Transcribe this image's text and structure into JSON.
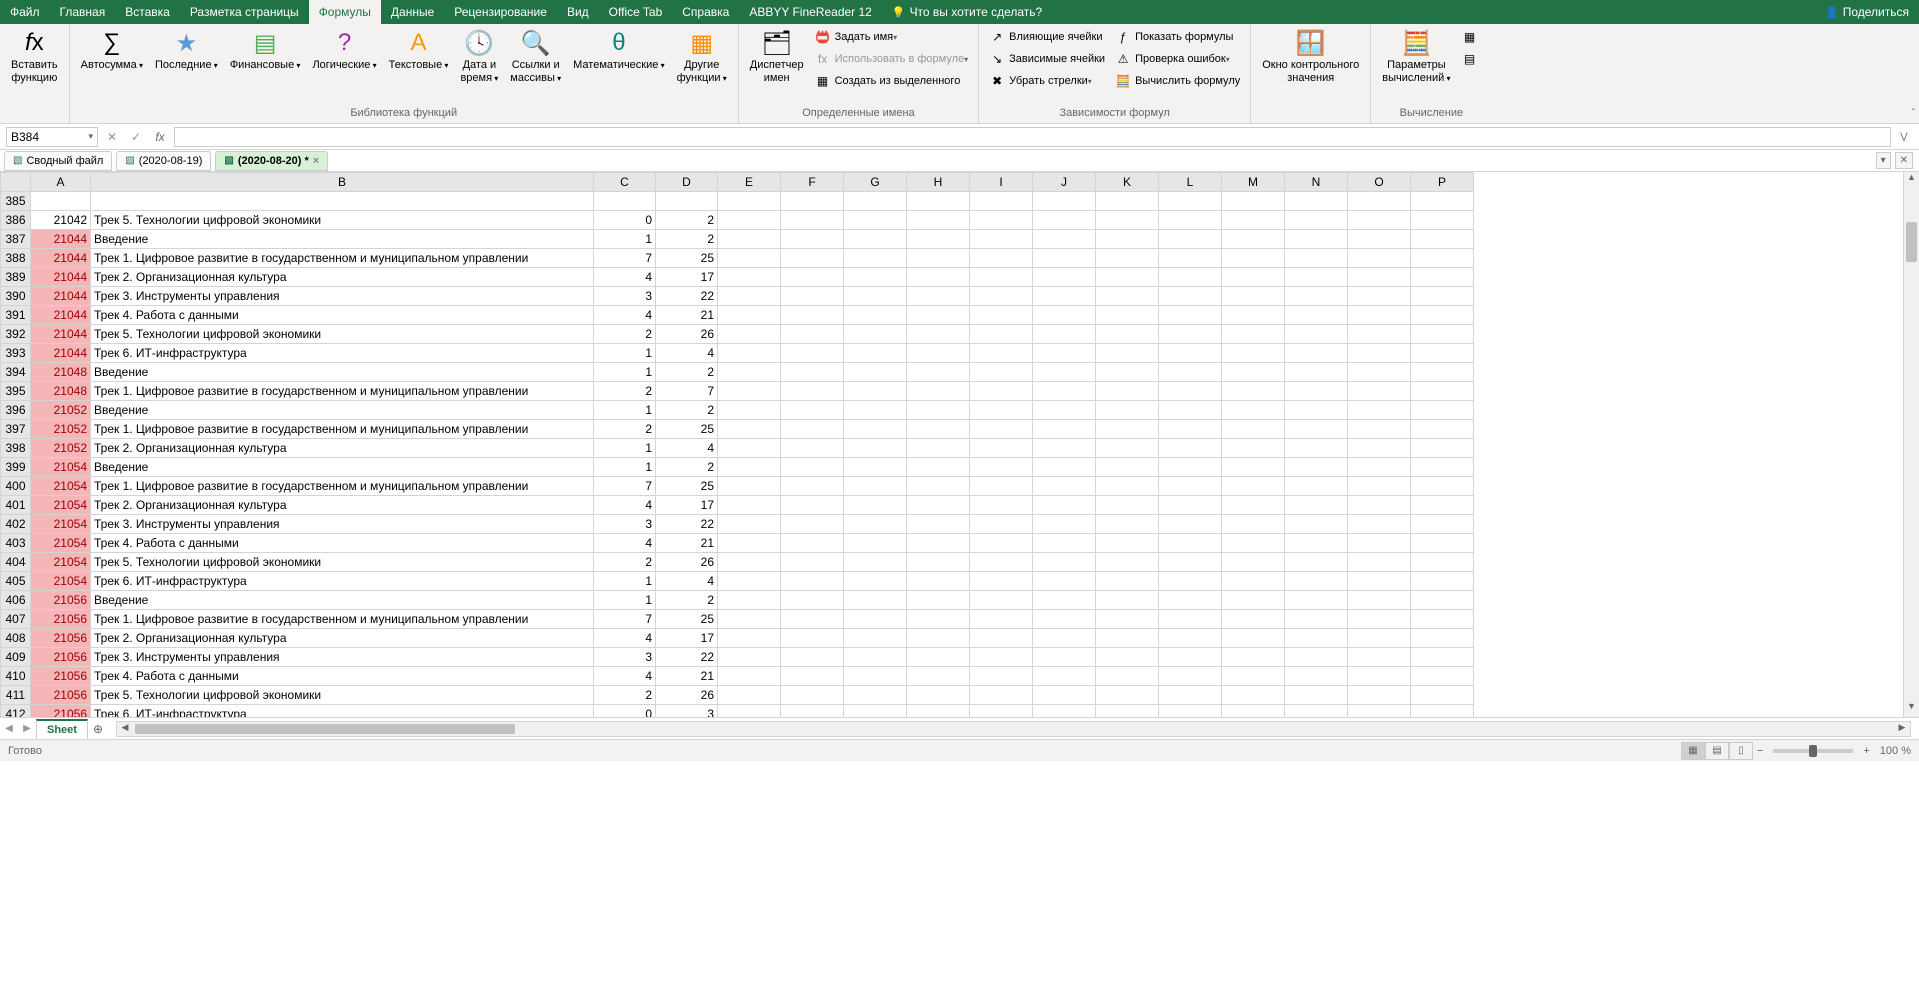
{
  "menubar": {
    "tabs": [
      "Файл",
      "Главная",
      "Вставка",
      "Разметка страницы",
      "Формулы",
      "Данные",
      "Рецензирование",
      "Вид",
      "Office Tab",
      "Справка",
      "ABBYY FineReader 12"
    ],
    "active": 4,
    "tellme": "Что вы хотите сделать?",
    "share": "Поделиться"
  },
  "ribbon": {
    "groups": {
      "g0": {
        "label": ""
      },
      "library": {
        "label": "Библиотека функций",
        "insertFn": "Вставить\nфункцию",
        "autosum": "Автосумма",
        "recent": "Последние",
        "financial": "Финансовые",
        "logical": "Логические",
        "text": "Текстовые",
        "datetime": "Дата и\nвремя",
        "lookup": "Ссылки и\nмассивы",
        "math": "Математические",
        "more": "Другие\nфункции"
      },
      "names": {
        "label": "Определенные имена",
        "manager": "Диспетчер\nимен",
        "define": "Задать имя",
        "useIn": "Использовать в формуле",
        "createFrom": "Создать из выделенного"
      },
      "audit": {
        "label": "Зависимости формул",
        "precedents": "Влияющие ячейки",
        "dependents": "Зависимые ячейки",
        "removeArrows": "Убрать стрелки",
        "showFormulas": "Показать формулы",
        "errorCheck": "Проверка ошибок",
        "evaluate": "Вычислить формулу"
      },
      "watch": {
        "label": "",
        "watch": "Окно контрольного\nзначения"
      },
      "calc": {
        "label": "Вычисление",
        "options": "Параметры\nвычислений"
      }
    }
  },
  "nameBox": "B384",
  "docTabs": [
    {
      "icon": "X",
      "label": "Сводный файл",
      "active": false,
      "closable": false
    },
    {
      "icon": "X",
      "label": "(2020-08-19)",
      "active": false,
      "closable": false
    },
    {
      "icon": "X",
      "label": "(2020-08-20) *",
      "active": true,
      "closable": true
    }
  ],
  "columns": [
    "A",
    "B",
    "C",
    "D",
    "E",
    "F",
    "G",
    "H",
    "I",
    "J",
    "K",
    "L",
    "M",
    "N",
    "O",
    "P"
  ],
  "startRow": 385,
  "rows": [
    {
      "r": 385,
      "a": "",
      "b": "",
      "c": "",
      "d": "",
      "hl": false
    },
    {
      "r": 386,
      "a": 21042,
      "b": "Трек 5. Технологии цифровой экономики",
      "c": 0,
      "d": 2,
      "hl": false
    },
    {
      "r": 387,
      "a": 21044,
      "b": "Введение",
      "c": 1,
      "d": 2,
      "hl": true
    },
    {
      "r": 388,
      "a": 21044,
      "b": "Трек 1. Цифровое развитие в государственном и муниципальном управлении",
      "c": 7,
      "d": 25,
      "hl": true
    },
    {
      "r": 389,
      "a": 21044,
      "b": "Трек 2. Организационная культура",
      "c": 4,
      "d": 17,
      "hl": true
    },
    {
      "r": 390,
      "a": 21044,
      "b": "Трек 3. Инструменты управления",
      "c": 3,
      "d": 22,
      "hl": true
    },
    {
      "r": 391,
      "a": 21044,
      "b": "Трек 4. Работа с данными",
      "c": 4,
      "d": 21,
      "hl": true
    },
    {
      "r": 392,
      "a": 21044,
      "b": "Трек 5. Технологии цифровой экономики",
      "c": 2,
      "d": 26,
      "hl": true
    },
    {
      "r": 393,
      "a": 21044,
      "b": "Трек 6. ИТ-инфраструктура",
      "c": 1,
      "d": 4,
      "hl": true
    },
    {
      "r": 394,
      "a": 21048,
      "b": "Введение",
      "c": 1,
      "d": 2,
      "hl": true
    },
    {
      "r": 395,
      "a": 21048,
      "b": "Трек 1. Цифровое развитие в государственном и муниципальном управлении",
      "c": 2,
      "d": 7,
      "hl": true
    },
    {
      "r": 396,
      "a": 21052,
      "b": "Введение",
      "c": 1,
      "d": 2,
      "hl": true
    },
    {
      "r": 397,
      "a": 21052,
      "b": "Трек 1. Цифровое развитие в государственном и муниципальном управлении",
      "c": 2,
      "d": 25,
      "hl": true
    },
    {
      "r": 398,
      "a": 21052,
      "b": "Трек 2. Организационная культура",
      "c": 1,
      "d": 4,
      "hl": true
    },
    {
      "r": 399,
      "a": 21054,
      "b": "Введение",
      "c": 1,
      "d": 2,
      "hl": true
    },
    {
      "r": 400,
      "a": 21054,
      "b": "Трек 1. Цифровое развитие в государственном и муниципальном управлении",
      "c": 7,
      "d": 25,
      "hl": true
    },
    {
      "r": 401,
      "a": 21054,
      "b": "Трек 2. Организационная культура",
      "c": 4,
      "d": 17,
      "hl": true
    },
    {
      "r": 402,
      "a": 21054,
      "b": "Трек 3. Инструменты управления",
      "c": 3,
      "d": 22,
      "hl": true
    },
    {
      "r": 403,
      "a": 21054,
      "b": "Трек 4. Работа с данными",
      "c": 4,
      "d": 21,
      "hl": true
    },
    {
      "r": 404,
      "a": 21054,
      "b": "Трек 5. Технологии цифровой экономики",
      "c": 2,
      "d": 26,
      "hl": true
    },
    {
      "r": 405,
      "a": 21054,
      "b": "Трек 6. ИТ-инфраструктура",
      "c": 1,
      "d": 4,
      "hl": true
    },
    {
      "r": 406,
      "a": 21056,
      "b": "Введение",
      "c": 1,
      "d": 2,
      "hl": true
    },
    {
      "r": 407,
      "a": 21056,
      "b": "Трек 1. Цифровое развитие в государственном и муниципальном управлении",
      "c": 7,
      "d": 25,
      "hl": true
    },
    {
      "r": 408,
      "a": 21056,
      "b": "Трек 2. Организационная культура",
      "c": 4,
      "d": 17,
      "hl": true
    },
    {
      "r": 409,
      "a": 21056,
      "b": "Трек 3. Инструменты управления",
      "c": 3,
      "d": 22,
      "hl": true
    },
    {
      "r": 410,
      "a": 21056,
      "b": "Трек 4. Работа с данными",
      "c": 4,
      "d": 21,
      "hl": true
    },
    {
      "r": 411,
      "a": 21056,
      "b": "Трек 5. Технологии цифровой экономики",
      "c": 2,
      "d": 26,
      "hl": true
    },
    {
      "r": 412,
      "a": 21056,
      "b": "Трек 6. ИТ-инфраструктура",
      "c": 0,
      "d": 3,
      "hl": true
    }
  ],
  "sheet": {
    "active": "Sheet"
  },
  "status": {
    "ready": "Готово",
    "zoom": "100 %"
  }
}
